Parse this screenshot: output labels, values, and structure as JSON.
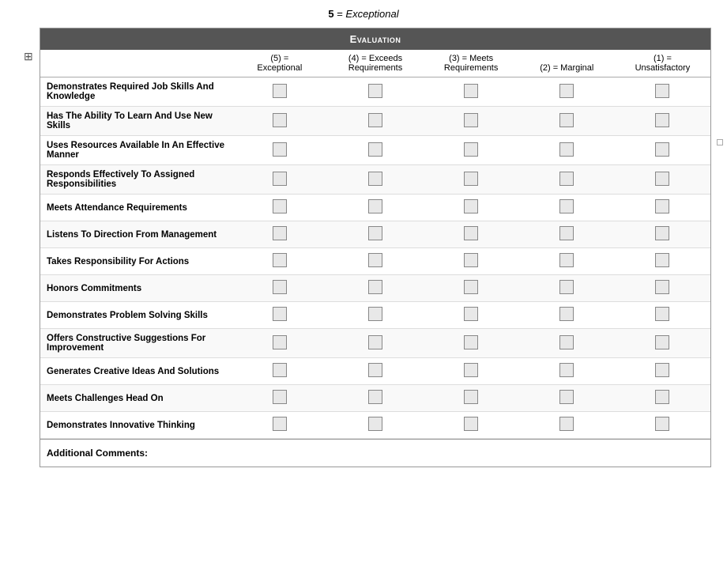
{
  "top": {
    "number": "5",
    "equals": "=",
    "word": "Exceptional"
  },
  "table": {
    "header": "Evaluation",
    "columns": [
      {
        "id": "col-label",
        "label": ""
      },
      {
        "id": "col-5",
        "label": "(5) = Exceptional"
      },
      {
        "id": "col-4",
        "label": "(4) = Exceeds Requirements"
      },
      {
        "id": "col-3",
        "label": "(3) = Meets Requirements"
      },
      {
        "id": "col-2",
        "label": "(2) = Marginal"
      },
      {
        "id": "col-1",
        "label": "(1) = Unsatisfactory"
      }
    ],
    "rows": [
      {
        "id": "row-1",
        "label": "Demonstrates Required Job Skills And Knowledge"
      },
      {
        "id": "row-2",
        "label": "Has The Ability To Learn And Use New Skills"
      },
      {
        "id": "row-3",
        "label": "Uses Resources Available In An Effective Manner"
      },
      {
        "id": "row-4",
        "label": "Responds Effectively To Assigned Responsibilities"
      },
      {
        "id": "row-5",
        "label": "Meets Attendance Requirements"
      },
      {
        "id": "row-6",
        "label": "Listens To Direction From Management"
      },
      {
        "id": "row-7",
        "label": "Takes Responsibility For Actions"
      },
      {
        "id": "row-8",
        "label": "Honors Commitments"
      },
      {
        "id": "row-9",
        "label": "Demonstrates Problem Solving Skills"
      },
      {
        "id": "row-10",
        "label": "Offers Constructive Suggestions For Improvement"
      },
      {
        "id": "row-11",
        "label": "Generates Creative Ideas And Solutions"
      },
      {
        "id": "row-12",
        "label": "Meets Challenges Head On"
      },
      {
        "id": "row-13",
        "label": "Demonstrates Innovative Thinking"
      }
    ]
  },
  "additional_comments_label": "Additional Comments:"
}
